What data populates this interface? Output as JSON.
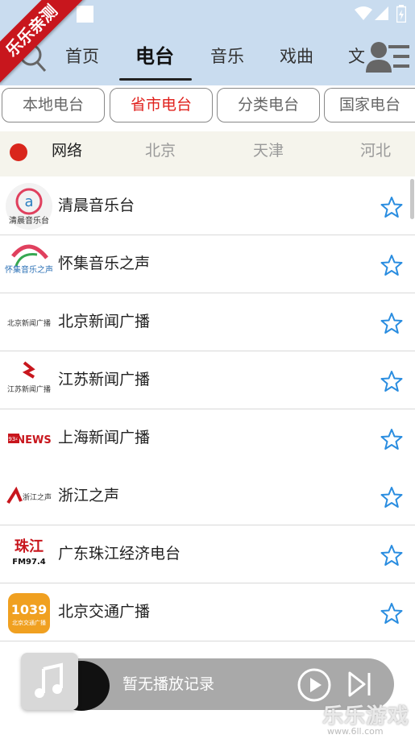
{
  "ribbon": {
    "text": "乐乐亲测"
  },
  "nav": {
    "tabs": [
      {
        "label": "首页",
        "active": false
      },
      {
        "label": "电台",
        "active": true
      },
      {
        "label": "音乐",
        "active": false
      },
      {
        "label": "戏曲",
        "active": false
      },
      {
        "label": "文",
        "active": false
      }
    ]
  },
  "subtabs": [
    {
      "label": "本地电台",
      "active": false
    },
    {
      "label": "省市电台",
      "active": true
    },
    {
      "label": "分类电台",
      "active": false
    },
    {
      "label": "国家电台",
      "active": false
    }
  ],
  "regions": [
    {
      "label": "网络",
      "active": true
    },
    {
      "label": "北京",
      "active": false
    },
    {
      "label": "天津",
      "active": false
    },
    {
      "label": "河北",
      "active": false
    }
  ],
  "stations": [
    {
      "name": "清晨音乐台",
      "logo_text": "清晨音乐台",
      "logo_mark": "a",
      "accent": "#e0405e"
    },
    {
      "name": "怀集音乐之声",
      "logo_text": "怀集音乐之声",
      "logo_mark": "",
      "accent": "#2a6fb5"
    },
    {
      "name": "北京新闻广播",
      "logo_text": "北京新闻广播",
      "logo_mark": "",
      "accent": "#333333"
    },
    {
      "name": "江苏新闻广播",
      "logo_text": "江苏新闻广播",
      "logo_mark": "",
      "accent": "#c8161d"
    },
    {
      "name": "上海新闻广播",
      "logo_text": "NEWS",
      "logo_mark": "934",
      "accent": "#c8161d"
    },
    {
      "name": "浙江之声",
      "logo_text": "浙江之声",
      "logo_mark": "",
      "accent": "#c8161d"
    },
    {
      "name": "广东珠江经济电台",
      "logo_text": "FM97.4",
      "logo_mark": "珠江",
      "accent": "#c8161d"
    },
    {
      "name": "北京交通广播",
      "logo_text": "北京交通广播",
      "logo_mark": "1039",
      "accent": "#f0a020"
    }
  ],
  "player": {
    "status_text": "暂无播放记录"
  },
  "watermark": {
    "title": "乐乐游戏",
    "url": "www.6ll.com"
  },
  "colors": {
    "topbar": "#c9dcef",
    "accent_red": "#e0221e",
    "star_blue": "#2a8de0"
  }
}
